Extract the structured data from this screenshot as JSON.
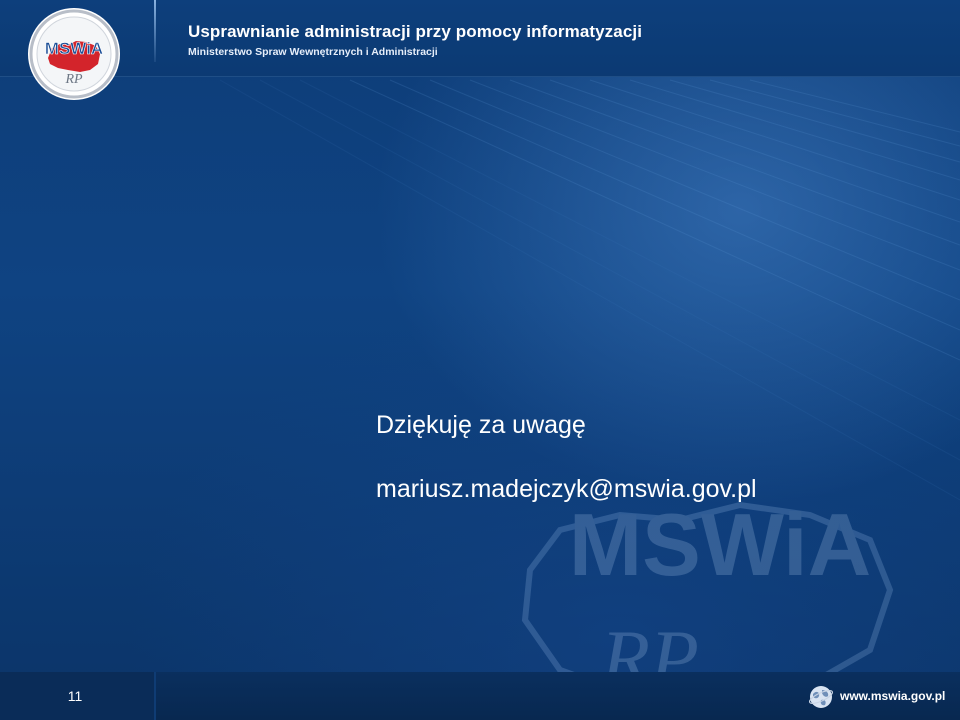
{
  "header": {
    "title": "Usprawnianie administracji przy pomocy informatyzacji",
    "subtitle": "Ministerstwo Spraw Wewnętrznych i Administracji",
    "logo_text": "MSWiA",
    "logo_sub": "RP"
  },
  "main": {
    "thanks": "Dziękuję za uwagę",
    "email": "mariusz.madejczyk@mswia.gov.pl"
  },
  "watermark": {
    "text": "MSWiA",
    "sub": "RP"
  },
  "footer": {
    "slide_number": "11",
    "site_url": "www.mswia.gov.pl"
  },
  "colors": {
    "background": "#0f4382",
    "header": "#0c3a73",
    "footer": "#082850",
    "text": "#ffffff",
    "logo_red": "#d3242b",
    "logo_ring": "#c9ced6"
  }
}
